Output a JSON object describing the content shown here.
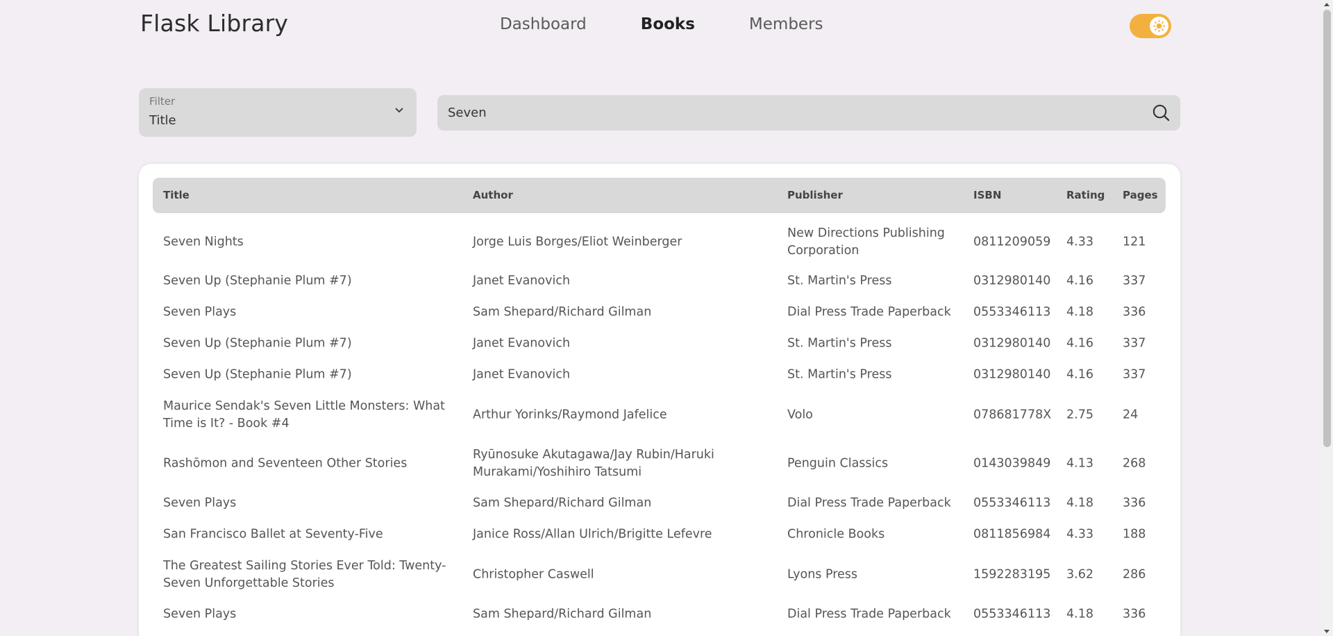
{
  "app": {
    "brand": "Flask Library"
  },
  "nav": {
    "items": [
      {
        "label": "Dashboard",
        "active": false
      },
      {
        "label": "Books",
        "active": true
      },
      {
        "label": "Members",
        "active": false
      }
    ]
  },
  "theme_toggle": {
    "state": "light",
    "accent_color": "#f4b03e"
  },
  "filter": {
    "label": "Filter",
    "value": "Title"
  },
  "search": {
    "value": "Seven"
  },
  "table": {
    "headers": {
      "title": "Title",
      "author": "Author",
      "publisher": "Publisher",
      "isbn": "ISBN",
      "rating": "Rating",
      "pages": "Pages"
    },
    "rows": [
      {
        "title": "Seven Nights",
        "author": "Jorge Luis Borges/Eliot Weinberger",
        "publisher": "New Directions Publishing Corporation",
        "isbn": "0811209059",
        "rating": "4.33",
        "pages": "121"
      },
      {
        "title": "Seven Up (Stephanie Plum #7)",
        "author": "Janet Evanovich",
        "publisher": "St. Martin's Press",
        "isbn": "0312980140",
        "rating": "4.16",
        "pages": "337"
      },
      {
        "title": "Seven Plays",
        "author": "Sam Shepard/Richard Gilman",
        "publisher": "Dial Press Trade Paperback",
        "isbn": "0553346113",
        "rating": "4.18",
        "pages": "336"
      },
      {
        "title": "Seven Up (Stephanie Plum #7)",
        "author": "Janet Evanovich",
        "publisher": "St. Martin's Press",
        "isbn": "0312980140",
        "rating": "4.16",
        "pages": "337"
      },
      {
        "title": "Seven Up (Stephanie Plum #7)",
        "author": "Janet Evanovich",
        "publisher": "St. Martin's Press",
        "isbn": "0312980140",
        "rating": "4.16",
        "pages": "337"
      },
      {
        "title": "Maurice Sendak's Seven Little Monsters: What Time is It? - Book #4",
        "author": "Arthur Yorinks/Raymond Jafelice",
        "publisher": "Volo",
        "isbn": "078681778X",
        "rating": "2.75",
        "pages": "24"
      },
      {
        "title": "Rashōmon and Seventeen Other Stories",
        "author": "Ryūnosuke Akutagawa/Jay Rubin/Haruki Murakami/Yoshihiro Tatsumi",
        "publisher": "Penguin Classics",
        "isbn": "0143039849",
        "rating": "4.13",
        "pages": "268"
      },
      {
        "title": "Seven Plays",
        "author": "Sam Shepard/Richard Gilman",
        "publisher": "Dial Press Trade Paperback",
        "isbn": "0553346113",
        "rating": "4.18",
        "pages": "336"
      },
      {
        "title": "San Francisco Ballet at Seventy-Five",
        "author": "Janice Ross/Allan Ulrich/Brigitte Lefevre",
        "publisher": "Chronicle Books",
        "isbn": "0811856984",
        "rating": "4.33",
        "pages": "188"
      },
      {
        "title": "The Greatest Sailing Stories Ever Told: Twenty-Seven Unforgettable Stories",
        "author": "Christopher Caswell",
        "publisher": "Lyons Press",
        "isbn": "1592283195",
        "rating": "3.62",
        "pages": "286"
      },
      {
        "title": "Seven Plays",
        "author": "Sam Shepard/Richard Gilman",
        "publisher": "Dial Press Trade Paperback",
        "isbn": "0553346113",
        "rating": "4.18",
        "pages": "336"
      }
    ]
  }
}
